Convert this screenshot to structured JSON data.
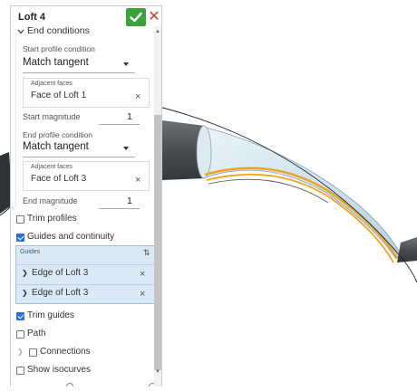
{
  "panel": {
    "title": "Loft 4",
    "ok_icon": "check-icon",
    "cancel_icon": "close-icon",
    "cancel_glyph": "✕"
  },
  "end_conditions": {
    "label": "End conditions",
    "start_profile_condition_label": "Start profile condition",
    "start_profile_condition_value": "Match tangent",
    "start_adjacent_faces_label": "Adjacent faces",
    "start_adjacent_face": "Face of Loft 1",
    "start_magnitude_label": "Start magnitude",
    "start_magnitude_value": "1",
    "end_profile_condition_label": "End profile condition",
    "end_profile_condition_value": "Match tangent",
    "end_adjacent_faces_label": "Adjacent faces",
    "end_adjacent_face": "Face of Loft 3",
    "end_magnitude_label": "End magnitude",
    "end_magnitude_value": "1"
  },
  "options": {
    "trim_profiles": {
      "label": "Trim profiles",
      "checked": false
    },
    "guides_and_continuity": {
      "label": "Guides and continuity",
      "checked": true
    },
    "trim_guides": {
      "label": "Trim guides",
      "checked": true
    },
    "path": {
      "label": "Path",
      "checked": false
    },
    "connections": {
      "label": "Connections",
      "checked": false
    },
    "show_isocurves": {
      "label": "Show isocurves",
      "checked": false
    }
  },
  "guides": {
    "label": "Guides",
    "items": [
      {
        "label": "Edge of Loft 3"
      },
      {
        "label": "Edge of Loft 3"
      }
    ]
  },
  "glyphs": {
    "close": "×",
    "chevron_right": "❯",
    "sort": "⇅"
  },
  "colors": {
    "ok_green": "#3aa43a",
    "cancel_red": "#d33333",
    "selection_orange": "#f0a21a",
    "guides_highlight": "#dbe9f6",
    "checkbox_blue": "#2a6fdb"
  }
}
